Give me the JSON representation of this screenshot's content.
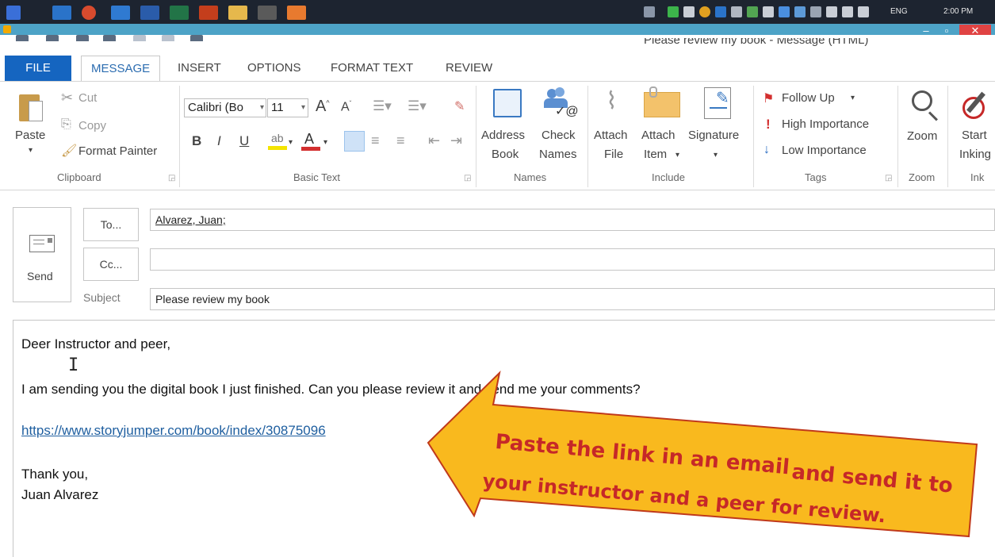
{
  "taskbar": {
    "tray_lang": "ENG",
    "tray_time": "2:00 PM"
  },
  "window": {
    "title": "Please review my book - Message (HTML)",
    "minimize": "–",
    "maximize": "▫",
    "close": "✕"
  },
  "ribbon": {
    "tabs": [
      {
        "label": "FILE"
      },
      {
        "label": "MESSAGE"
      },
      {
        "label": "INSERT"
      },
      {
        "label": "OPTIONS"
      },
      {
        "label": "FORMAT TEXT"
      },
      {
        "label": "REVIEW"
      }
    ],
    "clipboard": {
      "paste": "Paste",
      "cut": "Cut",
      "copy": "Copy",
      "format_painter": "Format Painter",
      "group": "Clipboard"
    },
    "basic_text": {
      "font_name": "Calibri (Bo",
      "font_size": "11",
      "bold": "B",
      "italic": "I",
      "underline": "U",
      "group": "Basic Text"
    },
    "names": {
      "address_book_1": "Address",
      "address_book_2": "Book",
      "check_names_1": "Check",
      "check_names_2": "Names",
      "group": "Names"
    },
    "include": {
      "attach_file_1": "Attach",
      "attach_file_2": "File",
      "attach_item_1": "Attach",
      "attach_item_2": "Item",
      "signature": "Signature",
      "group": "Include"
    },
    "tags": {
      "follow_up": "Follow Up",
      "high_importance": "High Importance",
      "low_importance": "Low Importance",
      "group": "Tags"
    },
    "zoom": {
      "label": "Zoom",
      "group": "Zoom"
    },
    "ink": {
      "start_1": "Start",
      "start_2": "Inking",
      "group": "Ink"
    }
  },
  "compose": {
    "send": "Send",
    "to_button": "To...",
    "cc_button": "Cc...",
    "to_value": "Alvarez, Juan;",
    "cc_value": "",
    "subject_label": "Subject",
    "subject_value": "Please review my book"
  },
  "body": {
    "greeting": "Deer Instructor and peer,",
    "paragraph": "I am sending you the digital book I just finished. Can you please review it and send me your comments?",
    "link": "https://www.storyjumper.com/book/index/30875096",
    "closing": "Thank you,",
    "signature": "Juan Alvarez"
  },
  "callout": {
    "line1": "Paste the link in an email",
    "line1b": "and send it to",
    "line2": "your instructor and a peer for review."
  },
  "colors": {
    "file_tab": "#1565c0",
    "title_bar": "#4da3c7",
    "callout_fill": "#f9b91e",
    "callout_text": "#c62828"
  }
}
